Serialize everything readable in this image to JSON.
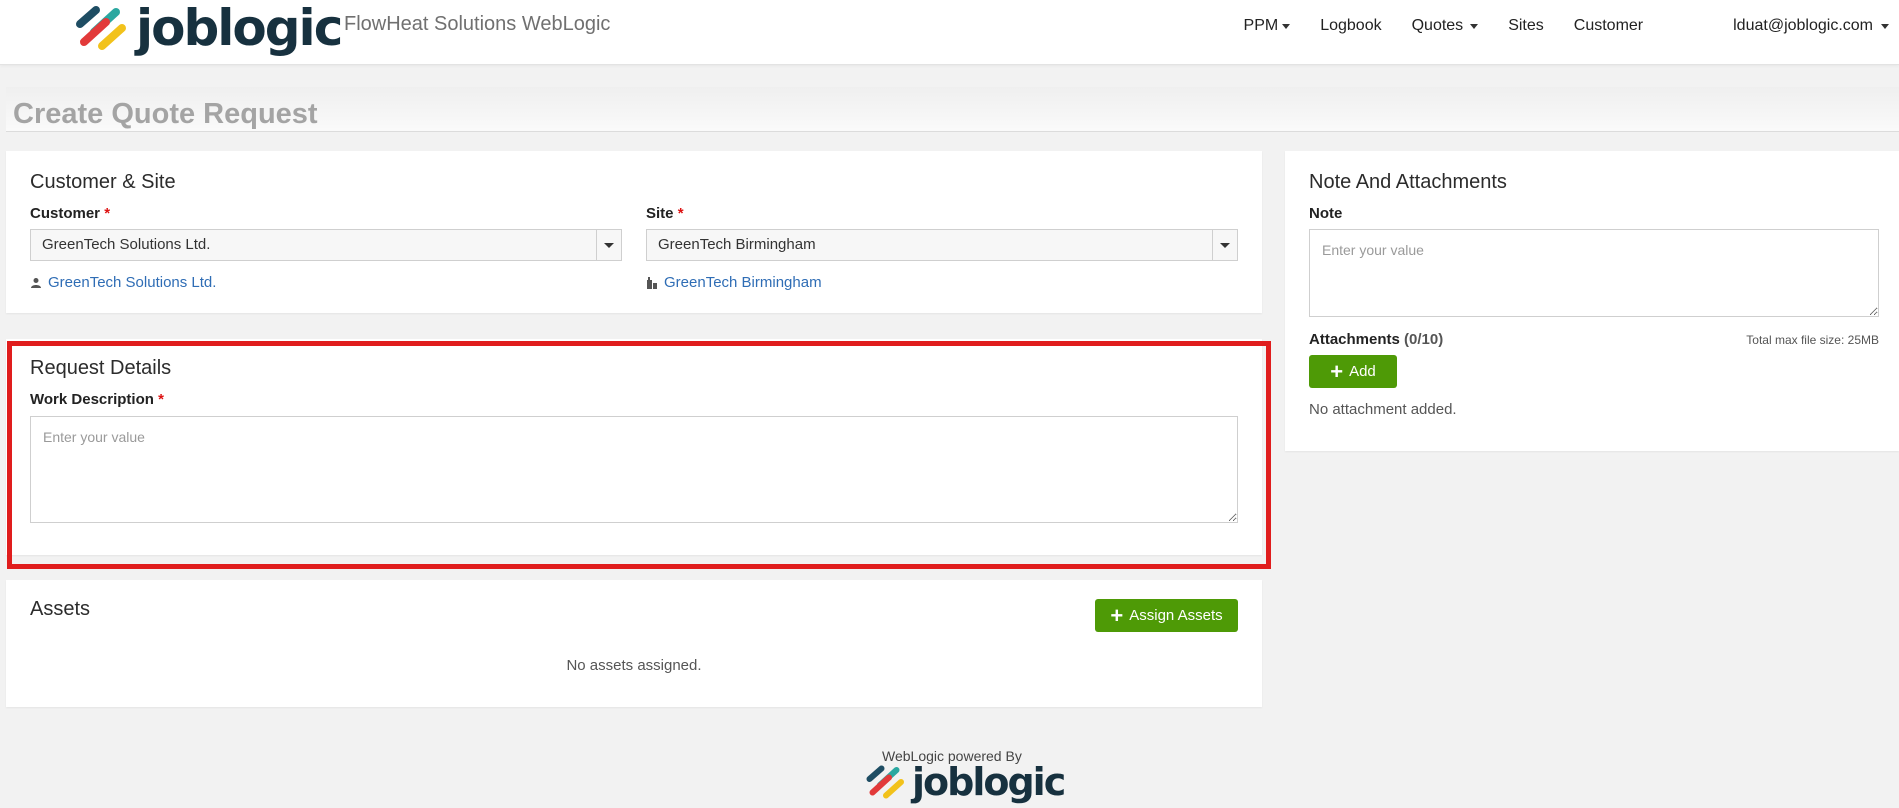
{
  "header": {
    "logo_text": "joblogic",
    "brand_subtitle": "FlowHeat Solutions WebLogic",
    "nav": {
      "ppm": "PPM",
      "logbook": "Logbook",
      "quotes": "Quotes",
      "sites": "Sites",
      "customer": "Customer",
      "user_email": "lduat@joblogic.com"
    }
  },
  "page": {
    "title": "Create Quote Request"
  },
  "customer_site": {
    "title": "Customer & Site",
    "customer_label": "Customer",
    "customer_value": "GreenTech Solutions Ltd.",
    "customer_link": "GreenTech Solutions Ltd.",
    "site_label": "Site",
    "site_value": "GreenTech Birmingham",
    "site_link": "GreenTech Birmingham",
    "required_mark": "*"
  },
  "request_details": {
    "title": "Request Details",
    "work_description_label": "Work Description",
    "work_description_placeholder": "Enter your value",
    "required_mark": "*"
  },
  "assets": {
    "title": "Assets",
    "assign_button": "Assign Assets",
    "empty_text": "No assets assigned."
  },
  "notes": {
    "title": "Note And Attachments",
    "note_label": "Note",
    "note_placeholder": "Enter your value",
    "attachments_label": "Attachments",
    "attachments_count": "(0/10)",
    "max_size": "Total max file size: 25MB",
    "add_button": "Add",
    "empty_text": "No attachment added."
  },
  "footer": {
    "powered_by": "WebLogic powered By",
    "logo_text": "joblogic"
  },
  "colors": {
    "accent_green": "#4e9a06",
    "link_blue": "#2f6db5",
    "highlight_red": "#e01d1d",
    "logo_dark": "#17313f"
  }
}
